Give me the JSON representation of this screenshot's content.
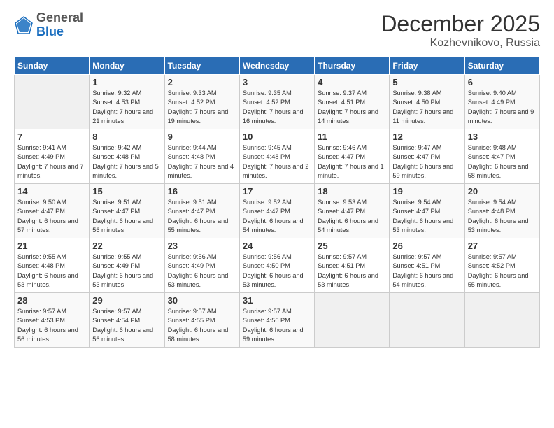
{
  "logo": {
    "general": "General",
    "blue": "Blue"
  },
  "header": {
    "month": "December 2025",
    "location": "Kozhevnikovo, Russia"
  },
  "days_of_week": [
    "Sunday",
    "Monday",
    "Tuesday",
    "Wednesday",
    "Thursday",
    "Friday",
    "Saturday"
  ],
  "weeks": [
    [
      {
        "day": "",
        "empty": true
      },
      {
        "day": "1",
        "sunrise": "9:32 AM",
        "sunset": "4:53 PM",
        "daylight": "7 hours and 21 minutes."
      },
      {
        "day": "2",
        "sunrise": "9:33 AM",
        "sunset": "4:52 PM",
        "daylight": "7 hours and 19 minutes."
      },
      {
        "day": "3",
        "sunrise": "9:35 AM",
        "sunset": "4:52 PM",
        "daylight": "7 hours and 16 minutes."
      },
      {
        "day": "4",
        "sunrise": "9:37 AM",
        "sunset": "4:51 PM",
        "daylight": "7 hours and 14 minutes."
      },
      {
        "day": "5",
        "sunrise": "9:38 AM",
        "sunset": "4:50 PM",
        "daylight": "7 hours and 11 minutes."
      },
      {
        "day": "6",
        "sunrise": "9:40 AM",
        "sunset": "4:49 PM",
        "daylight": "7 hours and 9 minutes."
      }
    ],
    [
      {
        "day": "7",
        "sunrise": "9:41 AM",
        "sunset": "4:49 PM",
        "daylight": "7 hours and 7 minutes."
      },
      {
        "day": "8",
        "sunrise": "9:42 AM",
        "sunset": "4:48 PM",
        "daylight": "7 hours and 5 minutes."
      },
      {
        "day": "9",
        "sunrise": "9:44 AM",
        "sunset": "4:48 PM",
        "daylight": "7 hours and 4 minutes."
      },
      {
        "day": "10",
        "sunrise": "9:45 AM",
        "sunset": "4:48 PM",
        "daylight": "7 hours and 2 minutes."
      },
      {
        "day": "11",
        "sunrise": "9:46 AM",
        "sunset": "4:47 PM",
        "daylight": "7 hours and 1 minute."
      },
      {
        "day": "12",
        "sunrise": "9:47 AM",
        "sunset": "4:47 PM",
        "daylight": "6 hours and 59 minutes."
      },
      {
        "day": "13",
        "sunrise": "9:48 AM",
        "sunset": "4:47 PM",
        "daylight": "6 hours and 58 minutes."
      }
    ],
    [
      {
        "day": "14",
        "sunrise": "9:50 AM",
        "sunset": "4:47 PM",
        "daylight": "6 hours and 57 minutes."
      },
      {
        "day": "15",
        "sunrise": "9:51 AM",
        "sunset": "4:47 PM",
        "daylight": "6 hours and 56 minutes."
      },
      {
        "day": "16",
        "sunrise": "9:51 AM",
        "sunset": "4:47 PM",
        "daylight": "6 hours and 55 minutes."
      },
      {
        "day": "17",
        "sunrise": "9:52 AM",
        "sunset": "4:47 PM",
        "daylight": "6 hours and 54 minutes."
      },
      {
        "day": "18",
        "sunrise": "9:53 AM",
        "sunset": "4:47 PM",
        "daylight": "6 hours and 54 minutes."
      },
      {
        "day": "19",
        "sunrise": "9:54 AM",
        "sunset": "4:47 PM",
        "daylight": "6 hours and 53 minutes."
      },
      {
        "day": "20",
        "sunrise": "9:54 AM",
        "sunset": "4:48 PM",
        "daylight": "6 hours and 53 minutes."
      }
    ],
    [
      {
        "day": "21",
        "sunrise": "9:55 AM",
        "sunset": "4:48 PM",
        "daylight": "6 hours and 53 minutes."
      },
      {
        "day": "22",
        "sunrise": "9:55 AM",
        "sunset": "4:49 PM",
        "daylight": "6 hours and 53 minutes."
      },
      {
        "day": "23",
        "sunrise": "9:56 AM",
        "sunset": "4:49 PM",
        "daylight": "6 hours and 53 minutes."
      },
      {
        "day": "24",
        "sunrise": "9:56 AM",
        "sunset": "4:50 PM",
        "daylight": "6 hours and 53 minutes."
      },
      {
        "day": "25",
        "sunrise": "9:57 AM",
        "sunset": "4:51 PM",
        "daylight": "6 hours and 53 minutes."
      },
      {
        "day": "26",
        "sunrise": "9:57 AM",
        "sunset": "4:51 PM",
        "daylight": "6 hours and 54 minutes."
      },
      {
        "day": "27",
        "sunrise": "9:57 AM",
        "sunset": "4:52 PM",
        "daylight": "6 hours and 55 minutes."
      }
    ],
    [
      {
        "day": "28",
        "sunrise": "9:57 AM",
        "sunset": "4:53 PM",
        "daylight": "6 hours and 56 minutes."
      },
      {
        "day": "29",
        "sunrise": "9:57 AM",
        "sunset": "4:54 PM",
        "daylight": "6 hours and 56 minutes."
      },
      {
        "day": "30",
        "sunrise": "9:57 AM",
        "sunset": "4:55 PM",
        "daylight": "6 hours and 58 minutes."
      },
      {
        "day": "31",
        "sunrise": "9:57 AM",
        "sunset": "4:56 PM",
        "daylight": "6 hours and 59 minutes."
      },
      {
        "day": "",
        "empty": true
      },
      {
        "day": "",
        "empty": true
      },
      {
        "day": "",
        "empty": true
      }
    ]
  ]
}
